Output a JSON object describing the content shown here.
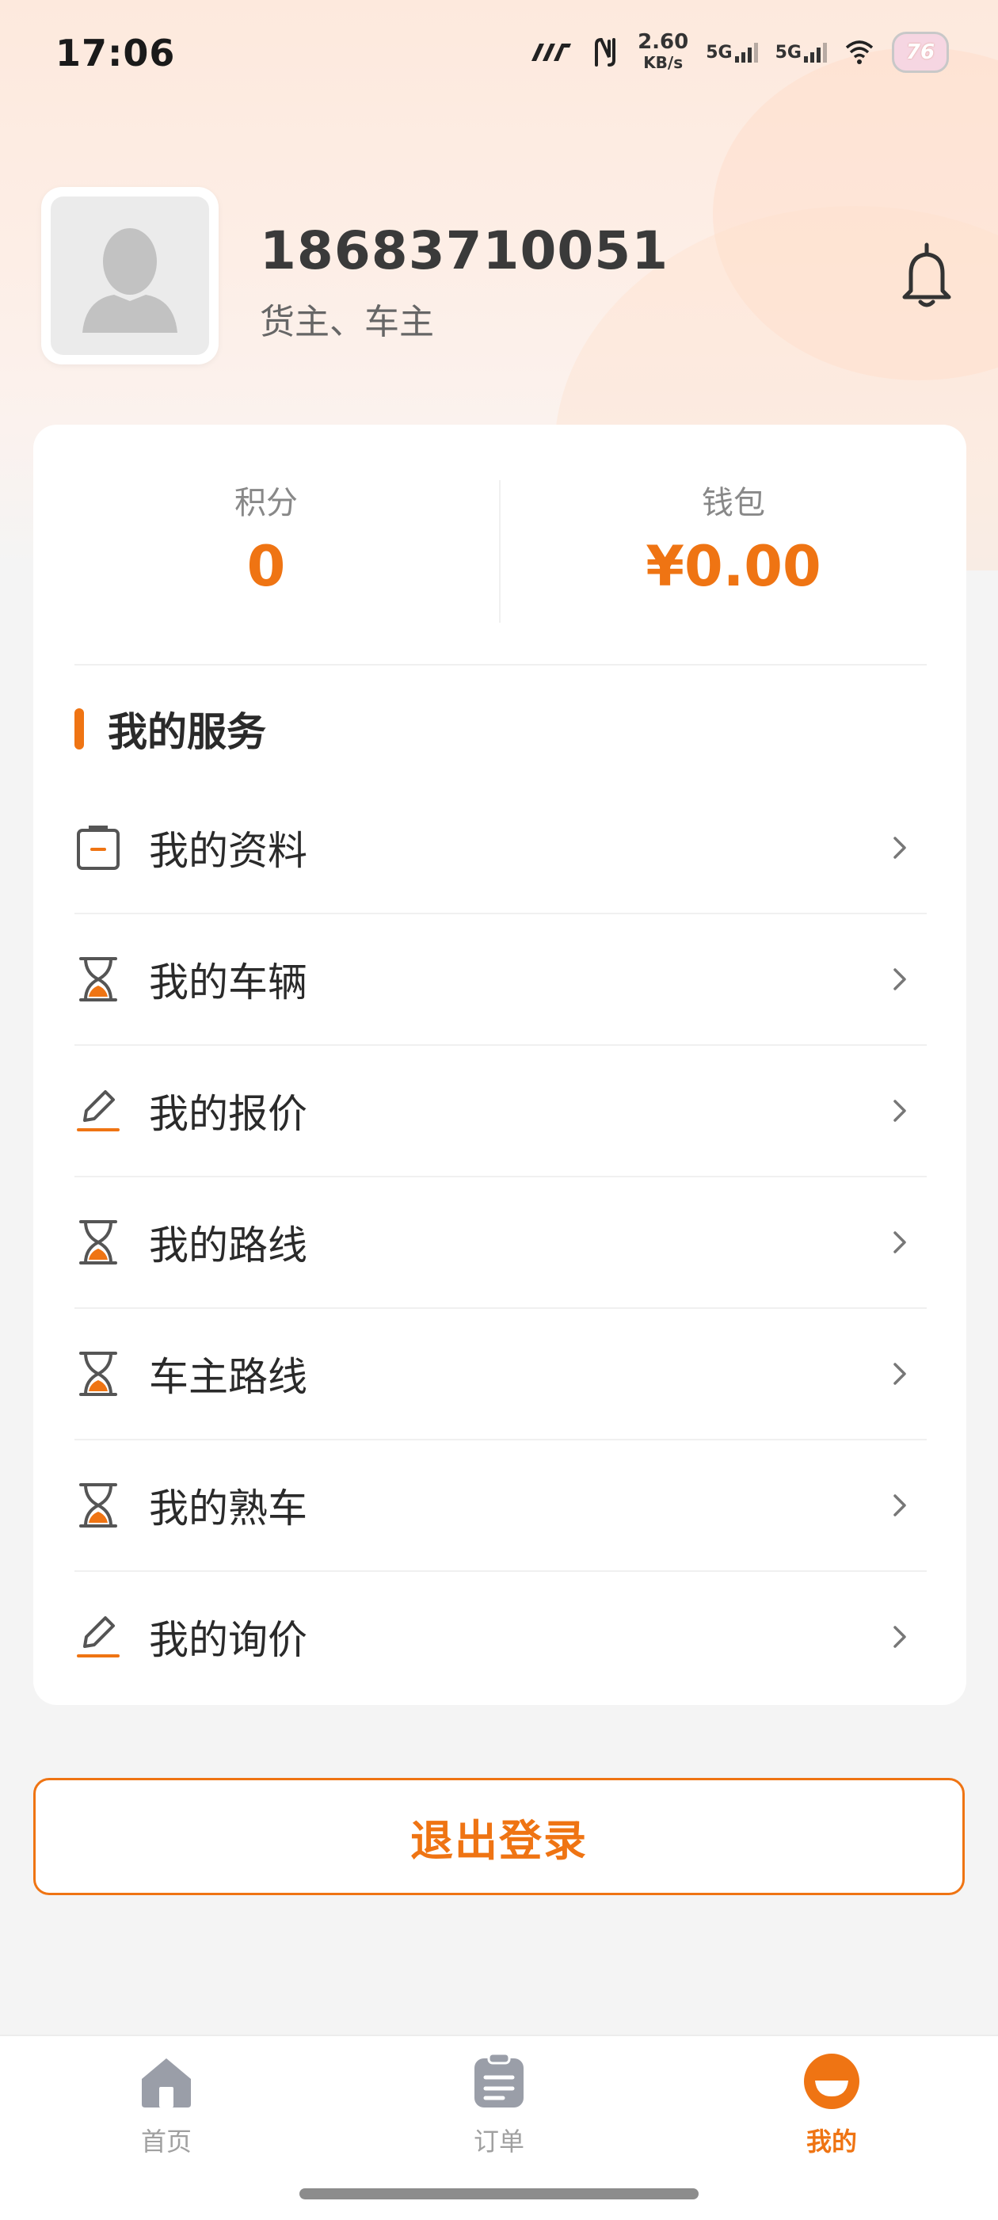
{
  "status_bar": {
    "time": "17:06",
    "net_speed_value": "2.60",
    "net_speed_unit": "KB/s",
    "sim1": "5G",
    "sim2": "5G",
    "battery": "76"
  },
  "profile": {
    "phone": "18683710051",
    "roles": "货主、车主",
    "avatar_icon": "person-silhouette-icon",
    "notification_icon": "bell-icon"
  },
  "stats": {
    "points_label": "积分",
    "points_value": "0",
    "wallet_label": "钱包",
    "wallet_value": "¥0.00"
  },
  "services": {
    "title": "我的服务",
    "items": [
      {
        "label": "我的资料",
        "icon": "clipboard-icon"
      },
      {
        "label": "我的车辆",
        "icon": "hourglass-icon"
      },
      {
        "label": "我的报价",
        "icon": "edit-pen-icon"
      },
      {
        "label": "我的路线",
        "icon": "hourglass-icon"
      },
      {
        "label": "车主路线",
        "icon": "hourglass-icon"
      },
      {
        "label": "我的熟车",
        "icon": "hourglass-icon"
      },
      {
        "label": "我的询价",
        "icon": "edit-pen-icon"
      }
    ]
  },
  "logout_label": "退出登录",
  "tabbar": {
    "items": [
      {
        "label": "首页",
        "icon": "home-icon",
        "active": false
      },
      {
        "label": "订单",
        "icon": "order-list-icon",
        "active": false
      },
      {
        "label": "我的",
        "icon": "profile-face-icon",
        "active": true
      }
    ]
  },
  "colors": {
    "accent": "#ef7413",
    "text": "#2a2a2a",
    "muted": "#888888",
    "background": "#f4f4f4"
  }
}
